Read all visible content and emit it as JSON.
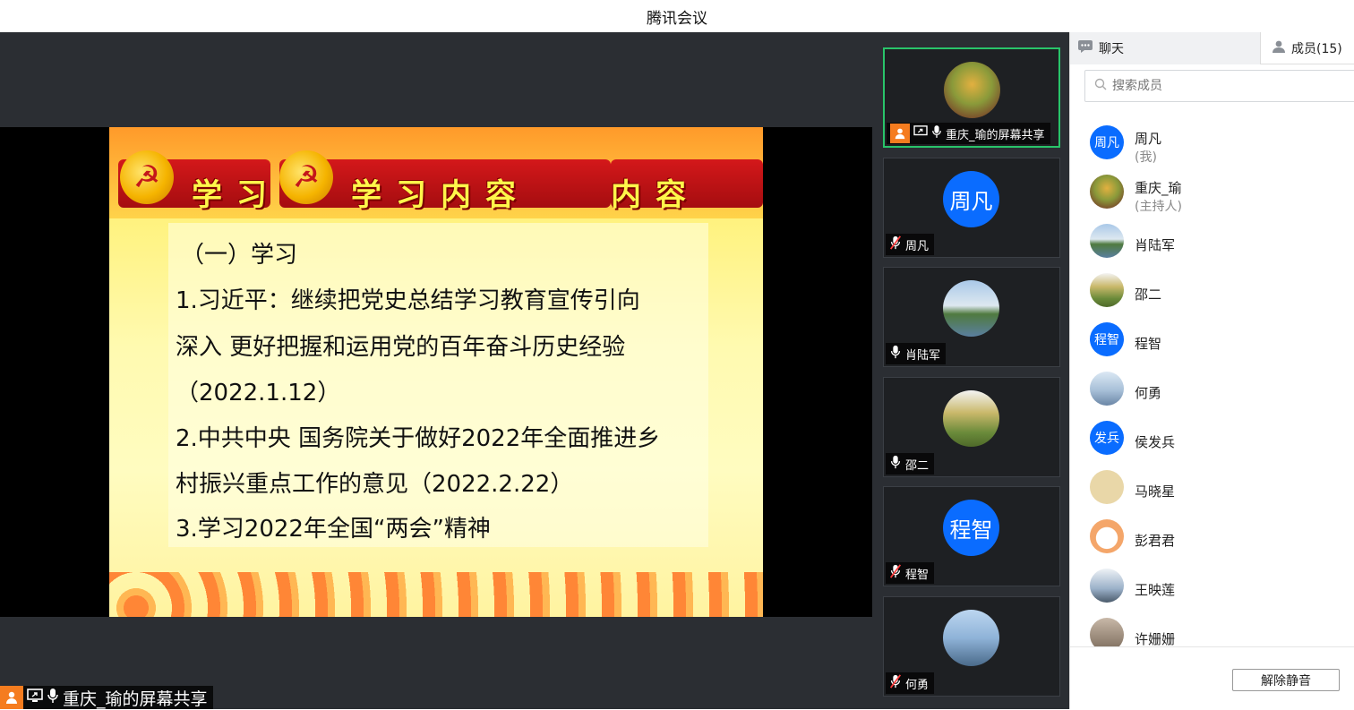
{
  "window": {
    "title": "腾讯会议"
  },
  "slide": {
    "title": "学习内容",
    "title_left_fragment": "学习",
    "title_right_fragment": "内容",
    "lines": [
      "（一）学习",
      "1.习近平：继续把党史总结学习教育宣传引向",
      "深入 更好把握和运用党的百年奋斗历史经验",
      "（2022.1.12）",
      "2.中共中央 国务院关于做好2022年全面推进乡",
      "村振兴重点工作的意见（2022.2.22）",
      "3.学习2022年全国“两会”精神"
    ]
  },
  "share_label": "重庆_瑜的屏幕共享",
  "video_tiles": [
    {
      "name": "重庆_瑜的屏幕共享",
      "avatar_text": "",
      "mic": "on",
      "sharing": true,
      "active": true,
      "color": "#7a8a5a"
    },
    {
      "name": "周凡",
      "avatar_text": "周凡",
      "mic": "muted",
      "color": "#0a6cff"
    },
    {
      "name": "肖陆军",
      "avatar_text": "",
      "mic": "on",
      "color": "#6c8fb5"
    },
    {
      "name": "邵二",
      "avatar_text": "",
      "mic": "on",
      "color": "#b6a25a"
    },
    {
      "name": "程智",
      "avatar_text": "程智",
      "mic": "muted",
      "color": "#0a6cff"
    },
    {
      "name": "何勇",
      "avatar_text": "",
      "mic": "muted",
      "color": "#5b86b6"
    }
  ],
  "sidebar": {
    "chat_tab": "聊天",
    "members_tab": "成员(15)",
    "search_placeholder": "搜索成员",
    "members": [
      {
        "name": "周凡",
        "sub": "(我)",
        "avatar_text": "周凡",
        "color": "#0a6cff"
      },
      {
        "name": "重庆_瑜",
        "sub": "(主持人)",
        "avatar_text": "",
        "color": "#8a7a4a"
      },
      {
        "name": "肖陆军",
        "sub": "",
        "avatar_text": "",
        "color": "#6c8fb5"
      },
      {
        "name": "邵二",
        "sub": "",
        "avatar_text": "",
        "color": "#b6a25a"
      },
      {
        "name": "程智",
        "sub": "",
        "avatar_text": "程智",
        "color": "#0a6cff"
      },
      {
        "name": "何勇",
        "sub": "",
        "avatar_text": "",
        "color": "#8fa8c8"
      },
      {
        "name": "侯发兵",
        "sub": "",
        "avatar_text": "发兵",
        "color": "#0a6cff"
      },
      {
        "name": "马晓星",
        "sub": "",
        "avatar_text": "",
        "color": "#e9d7a8"
      },
      {
        "name": "彭君君",
        "sub": "",
        "avatar_text": "",
        "color": "#f4a66a"
      },
      {
        "name": "王映莲",
        "sub": "",
        "avatar_text": "",
        "color": "#9ab0c8"
      },
      {
        "name": "许姗姗",
        "sub": "",
        "avatar_text": "",
        "color": "#7a6a5a"
      }
    ],
    "unmute_button": "解除静音"
  }
}
